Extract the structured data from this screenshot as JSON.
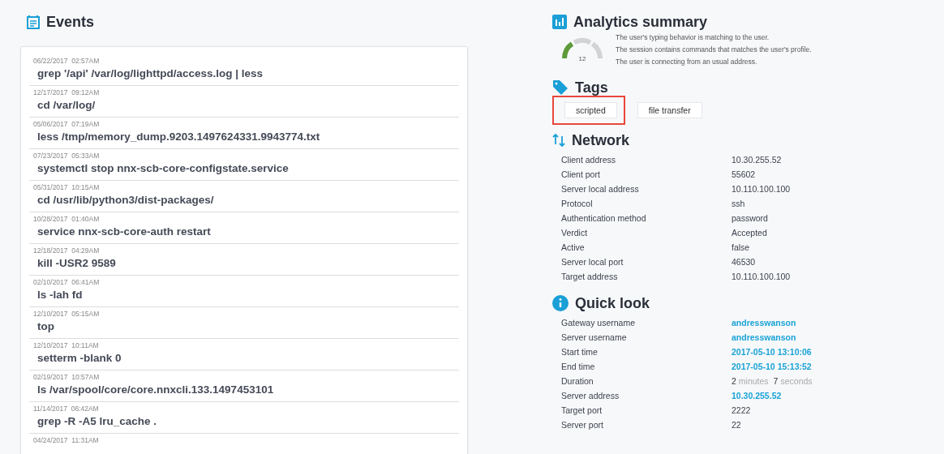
{
  "events": {
    "title": "Events",
    "items": [
      {
        "date": "06/22/2017",
        "time": "02:57AM",
        "command": "grep '/api' /var/log/lighttpd/access.log | less"
      },
      {
        "date": "12/17/2017",
        "time": "09:12AM",
        "command": "cd /var/log/"
      },
      {
        "date": "05/06/2017",
        "time": "07:19AM",
        "command": "less /tmp/memory_dump.9203.1497624331.9943774.txt"
      },
      {
        "date": "07/23/2017",
        "time": "05:33AM",
        "command": "systemctl stop nnx-scb-core-configstate.service"
      },
      {
        "date": "05/31/2017",
        "time": "10:15AM",
        "command": "cd /usr/lib/python3/dist-packages/"
      },
      {
        "date": "10/28/2017",
        "time": "01:40AM",
        "command": "service nnx-scb-core-auth restart"
      },
      {
        "date": "12/18/2017",
        "time": "04:29AM",
        "command": "kill -USR2 9589"
      },
      {
        "date": "02/10/2017",
        "time": "06:41AM",
        "command": "ls -lah fd"
      },
      {
        "date": "12/10/2017",
        "time": "05:15AM",
        "command": "top"
      },
      {
        "date": "12/10/2017",
        "time": "10:11AM",
        "command": "setterm -blank 0"
      },
      {
        "date": "02/19/2017",
        "time": "10:57AM",
        "command": "ls /var/spool/core/core.nnxcli.133.1497453101"
      },
      {
        "date": "11/14/2017",
        "time": "06:42AM",
        "command": "grep -R -A5 lru_cache ."
      },
      {
        "date": "04/24/2017",
        "time": "11:31AM"
      }
    ]
  },
  "analytics": {
    "title": "Analytics summary",
    "gauge": {
      "value": "12",
      "level": 0.33
    },
    "notes": [
      "The user's typing behavior is matching to the user.",
      "The session contains commands that matches the user's profile.",
      "The user is connecting from an usual address."
    ]
  },
  "tags": {
    "title": "Tags",
    "items": [
      {
        "label": "scripted",
        "highlighted": true
      },
      {
        "label": "file transfer",
        "highlighted": false
      }
    ]
  },
  "network": {
    "title": "Network",
    "rows": [
      {
        "label": "Client address",
        "value": "10.30.255.52"
      },
      {
        "label": "Client port",
        "value": "55602"
      },
      {
        "label": "Server local address",
        "value": "10.110.100.100"
      },
      {
        "label": "Protocol",
        "value": "ssh"
      },
      {
        "label": "Authentication method",
        "value": "password"
      },
      {
        "label": "Verdict",
        "value": "Accepted"
      },
      {
        "label": "Active",
        "value": "false"
      },
      {
        "label": "Server local port",
        "value": "46530"
      },
      {
        "label": "Target address",
        "value": "10.110.100.100"
      }
    ]
  },
  "quick_look": {
    "title": "Quick look",
    "rows": [
      {
        "label": "Gateway username",
        "kind": "link",
        "value": "andresswanson"
      },
      {
        "label": "Server username",
        "kind": "link",
        "value": "andresswanson"
      },
      {
        "label": "Start time",
        "kind": "link",
        "value": "2017-05-10 13:10:06"
      },
      {
        "label": "End time",
        "kind": "link",
        "value": "2017-05-10 15:13:52"
      },
      {
        "label": "Duration",
        "kind": "duration",
        "parts": [
          {
            "number": "2",
            "unit": "minutes"
          },
          {
            "number": "7",
            "unit": "seconds"
          }
        ]
      },
      {
        "label": "Server address",
        "kind": "link",
        "value": "10.30.255.52"
      },
      {
        "label": "Target port",
        "kind": "plain",
        "value": "2222"
      },
      {
        "label": "Server port",
        "kind": "plain",
        "value": "22"
      }
    ]
  }
}
